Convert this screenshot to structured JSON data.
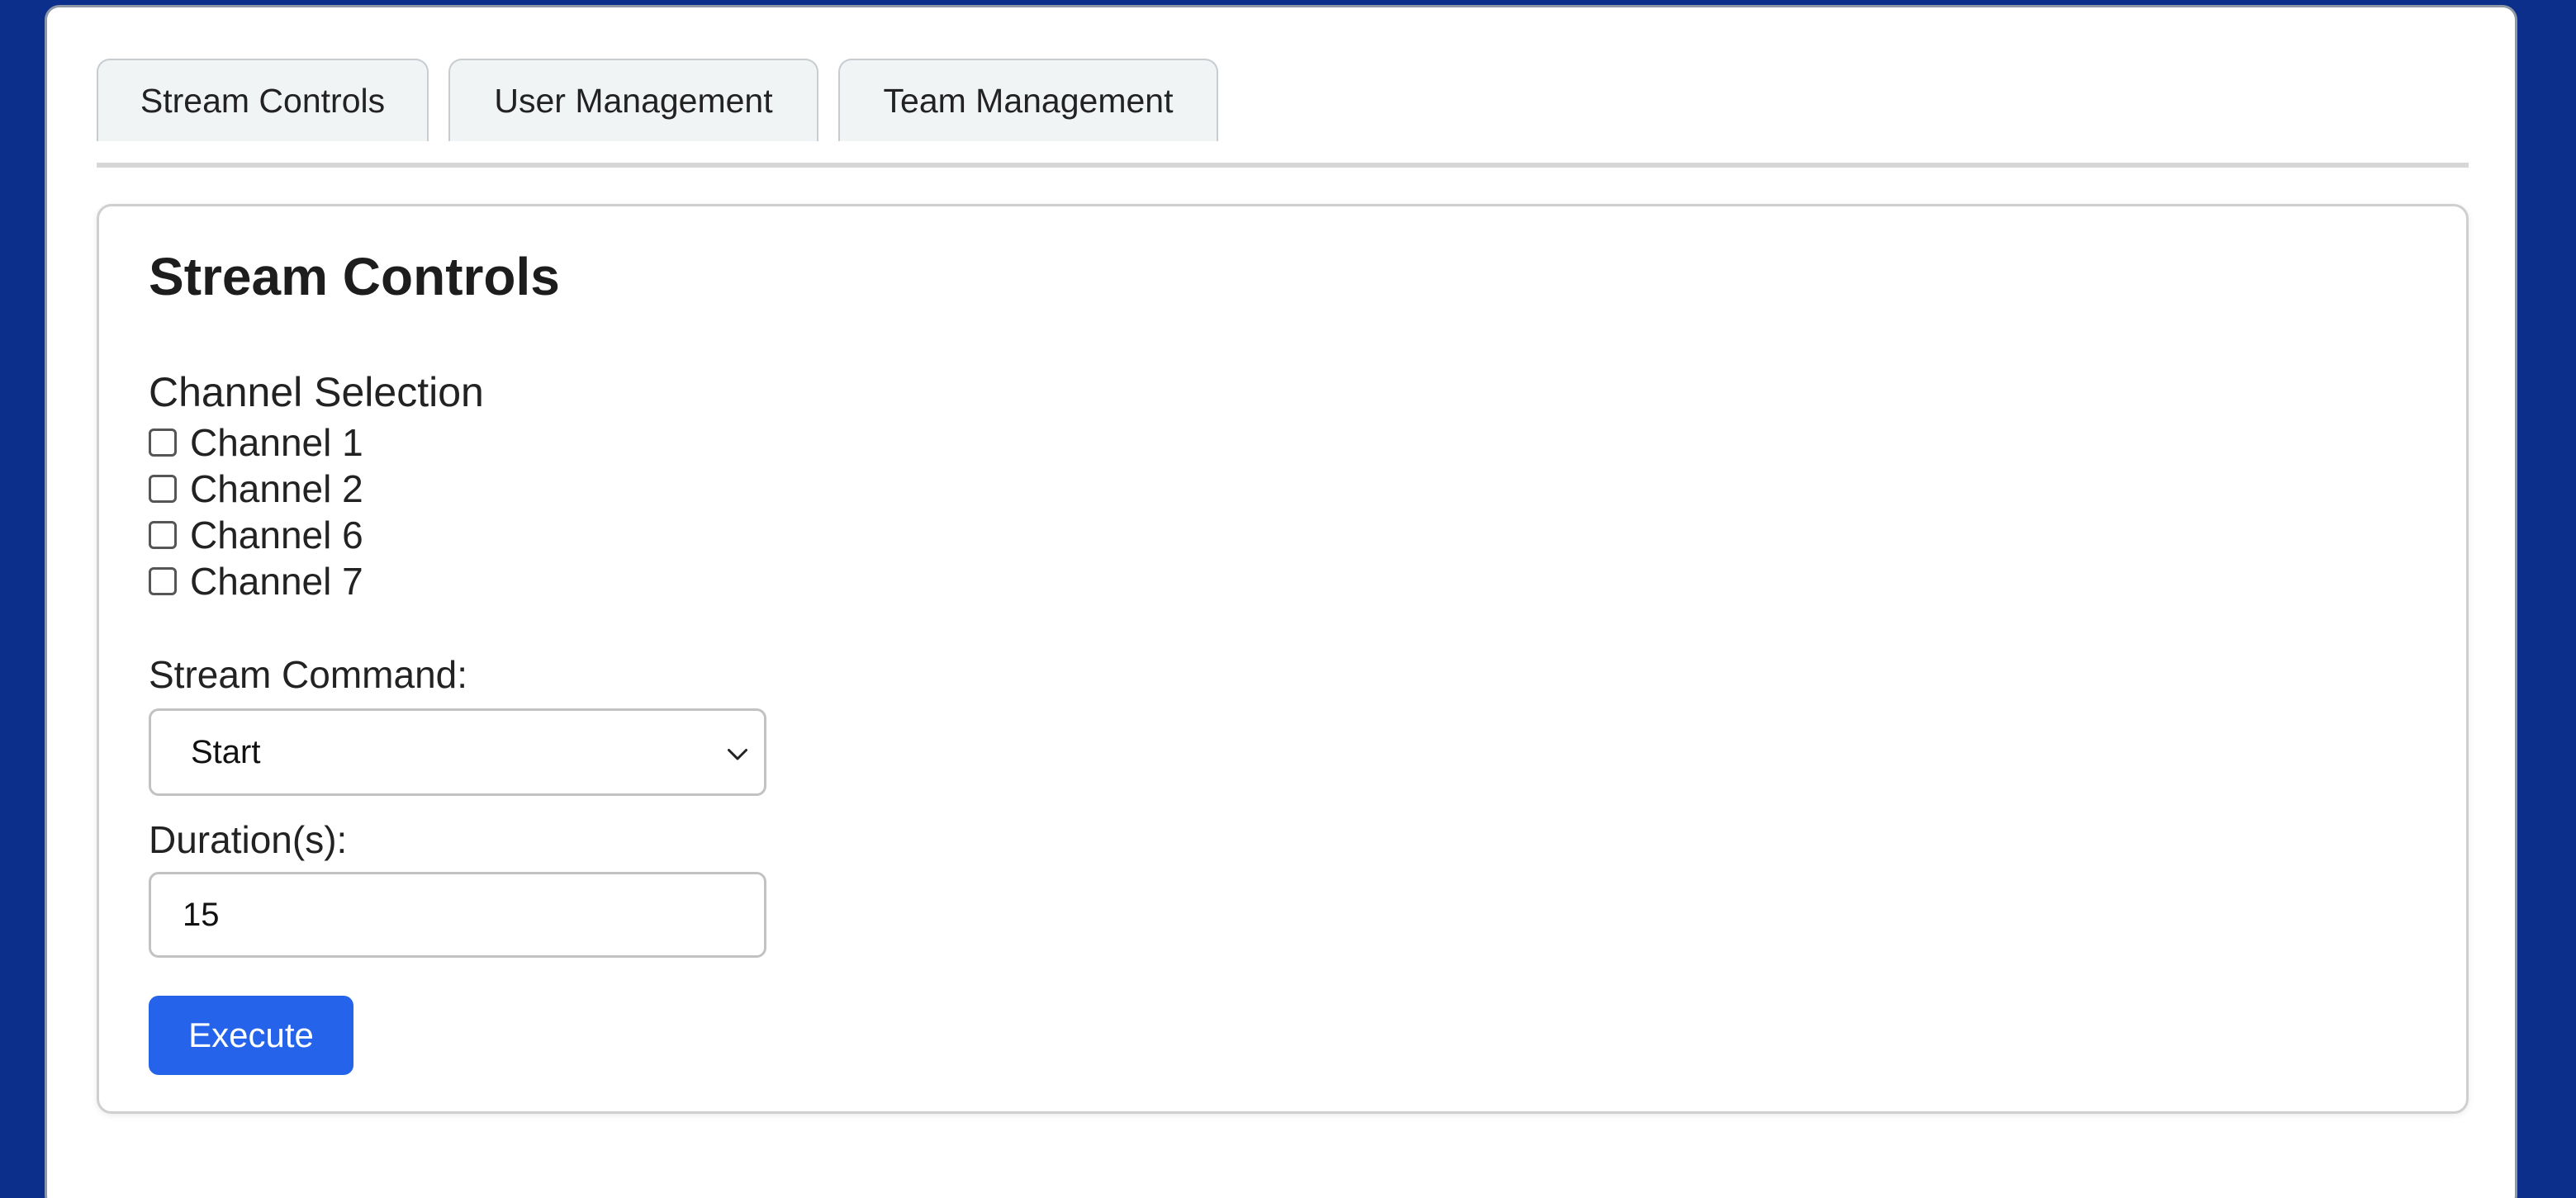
{
  "tabs": [
    {
      "label": "Stream Controls"
    },
    {
      "label": "User Management"
    },
    {
      "label": "Team Management"
    }
  ],
  "panel": {
    "title": "Stream Controls",
    "channel_section": {
      "label": "Channel Selection",
      "channels": [
        {
          "label": "Channel 1",
          "checked": false
        },
        {
          "label": "Channel 2",
          "checked": false
        },
        {
          "label": "Channel 6",
          "checked": false
        },
        {
          "label": "Channel 7",
          "checked": false
        }
      ]
    },
    "stream_command": {
      "label": "Stream Command:",
      "selected": "Start"
    },
    "duration": {
      "label": "Duration(s):",
      "value": "15"
    },
    "execute_label": "Execute"
  },
  "colors": {
    "frame": "#0b2f8a",
    "primary_button": "#2563eb",
    "tab_background": "#f1f4f5"
  },
  "icons": {
    "select_chevron": "chevron-down-icon"
  }
}
